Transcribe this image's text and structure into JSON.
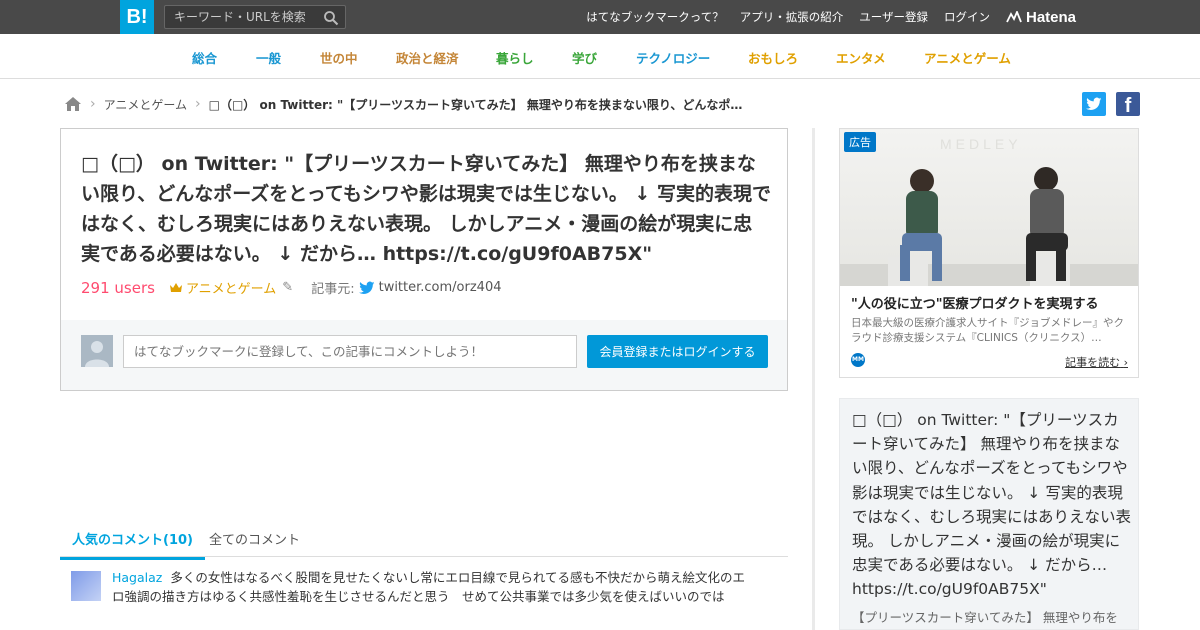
{
  "topbar": {
    "logo": "B!",
    "search_placeholder": "キーワード・URLを検索",
    "links": [
      "はてなブックマークって？",
      "アプリ・拡張の紹介",
      "ユーザー登録",
      "ログイン"
    ],
    "brand": "Hatena"
  },
  "categories": [
    {
      "label": "総合",
      "color": "#1a97d2"
    },
    {
      "label": "一般",
      "color": "#1a97d2"
    },
    {
      "label": "世の中",
      "color": "#c48638"
    },
    {
      "label": "政治と経済",
      "color": "#c48638"
    },
    {
      "label": "暮らし",
      "color": "#3aa63a"
    },
    {
      "label": "学び",
      "color": "#3aa63a"
    },
    {
      "label": "テクノロジー",
      "color": "#1a97d2"
    },
    {
      "label": "おもしろ",
      "color": "#e0a000"
    },
    {
      "label": "エンタメ",
      "color": "#e0a000"
    },
    {
      "label": "アニメとゲーム",
      "color": "#e0a000"
    }
  ],
  "breadcrumb": {
    "category": "アニメとゲーム",
    "current": "□（□） on Twitter: \"【プリーツスカート穿いてみた】 無理やり布を挟まない限り、どんなポーズ…"
  },
  "entry": {
    "title": "□（□） on Twitter: \"【プリーツスカート穿いてみた】 無理やり布を挟まない限り、どんなポーズをとってもシワや影は現実では生じない。 ↓ 写実的表現ではなく、むしろ現実にはありえない表現。 しかしアニメ・漫画の絵が現実に忠実である必要はない。 ↓ だから… https://t.co/gU9f0AB75X\"",
    "users": "291 users",
    "category": "アニメとゲーム",
    "source_label": "記事元:",
    "source": "twitter.com/orz404",
    "comment_placeholder": "はてなブックマークに登録して、この記事にコメントしよう！",
    "login_button": "会員登録またはログインする"
  },
  "tabs": {
    "popular": "人気のコメント(10)",
    "all": "全てのコメント"
  },
  "comments": [
    {
      "user": "Hagalaz",
      "text": "多くの女性はなるべく股間を見せたくないし常にエロ目線で見られてる感も不快だから萌え絵文化のエロ強調の描き方はゆるく共感性羞恥を生じさせるんだと思う　せめて公共事業では多少気を使えばいいのでは"
    }
  ],
  "ad": {
    "badge": "広告",
    "title": "\"人の役に立つ\"医療プロダクトを実現する",
    "description": "日本最大級の医療介護求人サイト『ジョブメドレー』やクラウド診療支援システム『CLINICS（クリニクス）…",
    "logo": "MM",
    "read_more": "記事を読む"
  },
  "sidebox": {
    "title": "□（□） on Twitter: \"【プリーツスカート穿いてみた】 無理やり布を挟まない限り、どんなポーズをとってもシワや影は現実では生じない。 ↓ 写実的表現ではなく、むしろ現実にはありえない表現。 しかしアニメ・漫画の絵が現実に忠実である必要はない。 ↓ だから… https://t.co/gU9f0AB75X\"",
    "snippet": "【プリーツスカート穿いてみた】 無理やり布を"
  },
  "colors": {
    "accent": "#00a4de",
    "users": "#ff4b6f",
    "topbar": "#494949",
    "twitter": "#1da1f2",
    "facebook": "#3b5998"
  }
}
